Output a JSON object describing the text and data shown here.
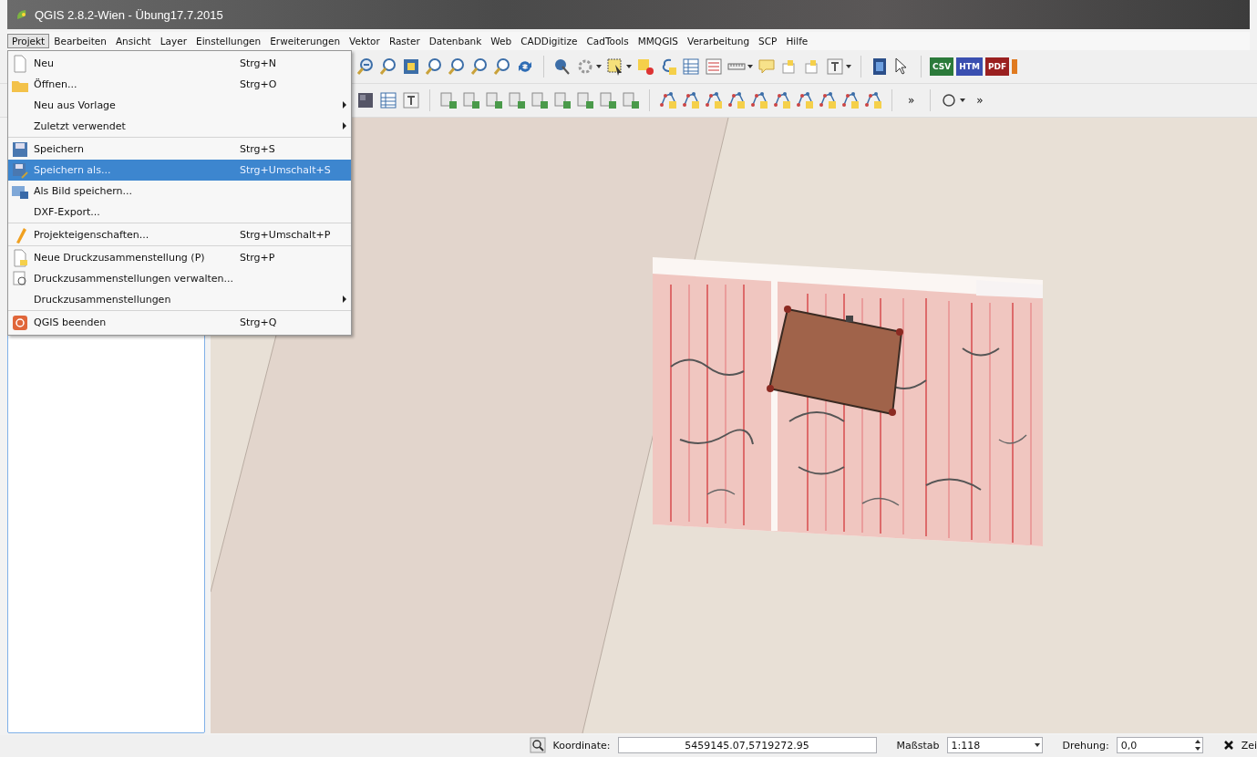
{
  "window": {
    "title": "QGIS 2.8.2-Wien - Übung17.7.2015"
  },
  "menu_bar": [
    {
      "label": "Projekt",
      "selected": true
    },
    {
      "label": "Bearbeiten",
      "selected": false
    },
    {
      "label": "Ansicht",
      "selected": false
    },
    {
      "label": "Layer",
      "selected": false
    },
    {
      "label": "Einstellungen",
      "selected": false
    },
    {
      "label": "Erweiterungen",
      "selected": false
    },
    {
      "label": "Vektor",
      "selected": false
    },
    {
      "label": "Raster",
      "selected": false
    },
    {
      "label": "Datenbank",
      "selected": false
    },
    {
      "label": "Web",
      "selected": false
    },
    {
      "label": "CADDigitize",
      "selected": false
    },
    {
      "label": "CadTools",
      "selected": false
    },
    {
      "label": "MMQGIS",
      "selected": false
    },
    {
      "label": "Verarbeitung",
      "selected": false
    },
    {
      "label": "SCP",
      "selected": false
    },
    {
      "label": "Hilfe",
      "selected": false
    }
  ],
  "menu": {
    "items": [
      {
        "label": "Neu",
        "shortcut": "Strg+N",
        "submenu": false,
        "selected": false,
        "separator_after": false
      },
      {
        "label": "Öffnen...",
        "shortcut": "Strg+O",
        "submenu": false,
        "selected": false,
        "separator_after": false
      },
      {
        "label": "Neu aus Vorlage",
        "submenu": true,
        "selected": false,
        "separator_after": false
      },
      {
        "label": "Zuletzt verwendet",
        "submenu": true,
        "selected": false,
        "separator_after": true
      },
      {
        "label": "Speichern",
        "shortcut": "Strg+S",
        "submenu": false,
        "selected": false,
        "separator_after": false
      },
      {
        "label": "Speichern als...",
        "shortcut": "Strg+Umschalt+S",
        "submenu": false,
        "selected": true,
        "separator_after": false
      },
      {
        "label": "Als Bild speichern...",
        "submenu": false,
        "selected": false,
        "separator_after": false
      },
      {
        "label": "DXF-Export...",
        "submenu": false,
        "selected": false,
        "separator_after": true
      },
      {
        "label": "Projekteigenschaften...",
        "shortcut": "Strg+Umschalt+P",
        "submenu": false,
        "selected": false,
        "separator_after": true
      },
      {
        "label": "Neue Druckzusammenstellung (P)",
        "shortcut": "Strg+P",
        "submenu": false,
        "selected": false,
        "separator_after": false
      },
      {
        "label": "Druckzusammenstellungen verwalten...",
        "submenu": false,
        "selected": false,
        "separator_after": false
      },
      {
        "label": "Druckzusammenstellungen",
        "submenu": true,
        "selected": false,
        "separator_after": true
      },
      {
        "label": "QGIS beenden",
        "shortcut": "Strg+Q",
        "submenu": false,
        "selected": false,
        "separator_after": false
      }
    ]
  },
  "toolbar": {
    "export_buttons": [
      "CSV",
      "HTM",
      "PDF"
    ],
    "overflow": [
      "»",
      "»"
    ]
  },
  "status_bar": {
    "coordinate_label": "Koordinate:",
    "coordinate": "5459145.07,5719272.95",
    "scale_label": "Maßstab",
    "scale": "1:118",
    "rotation_label": "Drehung:",
    "rotation": "0,0",
    "render_label": "Zei"
  }
}
